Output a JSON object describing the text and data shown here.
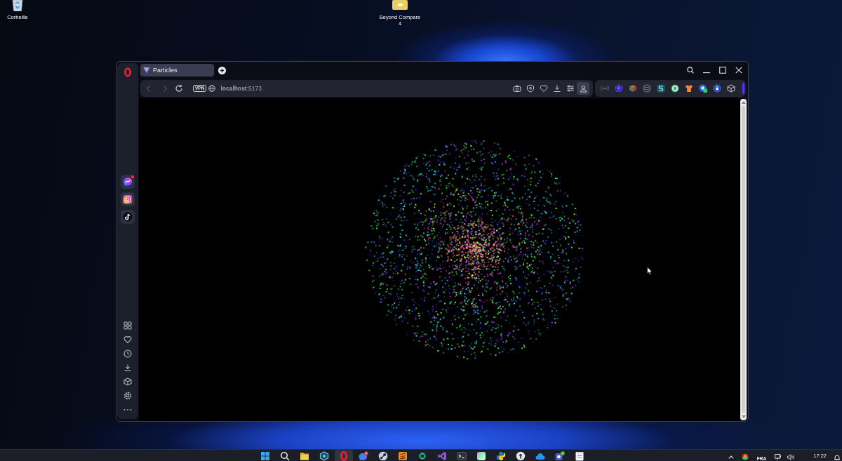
{
  "desktop_shortcuts": [
    {
      "kind": "recycle_bin",
      "label": "Corbeille"
    },
    {
      "kind": "app",
      "label": "Beyond Compare 4"
    }
  ],
  "browser": {
    "tabs": [
      {
        "title": "Particles",
        "selected": true
      }
    ],
    "nav": {
      "back_disabled": true,
      "forward_disabled": true
    },
    "vpn_badge": "VPN",
    "address": "**localhost**:5173"
  },
  "sidebar": {
    "apps": [
      {
        "kind": "messenger",
        "notification": true
      },
      {
        "kind": "instagram",
        "notification": false
      },
      {
        "kind": "tiktok",
        "notification": false
      }
    ]
  },
  "taskbar": {
    "apps": [
      {
        "kind": "start",
        "active": false
      },
      {
        "kind": "search",
        "active": false
      },
      {
        "kind": "folder",
        "active": false
      },
      {
        "kind": "hexagon",
        "active": false
      },
      {
        "kind": "opera",
        "active": true
      },
      {
        "kind": "chat",
        "active": false
      },
      {
        "kind": "steam",
        "active": false
      },
      {
        "kind": "stripes",
        "active": false
      },
      {
        "kind": "orb",
        "active": false
      },
      {
        "kind": "ribbon",
        "active": false
      },
      {
        "kind": "terminal",
        "active": false
      },
      {
        "kind": "gradient",
        "active": false
      },
      {
        "kind": "knot",
        "active": false
      },
      {
        "kind": "keyhole",
        "active": false
      },
      {
        "kind": "cloud",
        "active": false
      },
      {
        "kind": "tile",
        "active": false
      },
      {
        "kind": "notepad",
        "active": false
      }
    ],
    "tray": {
      "language": "FRA",
      "time": "17:22"
    }
  }
}
